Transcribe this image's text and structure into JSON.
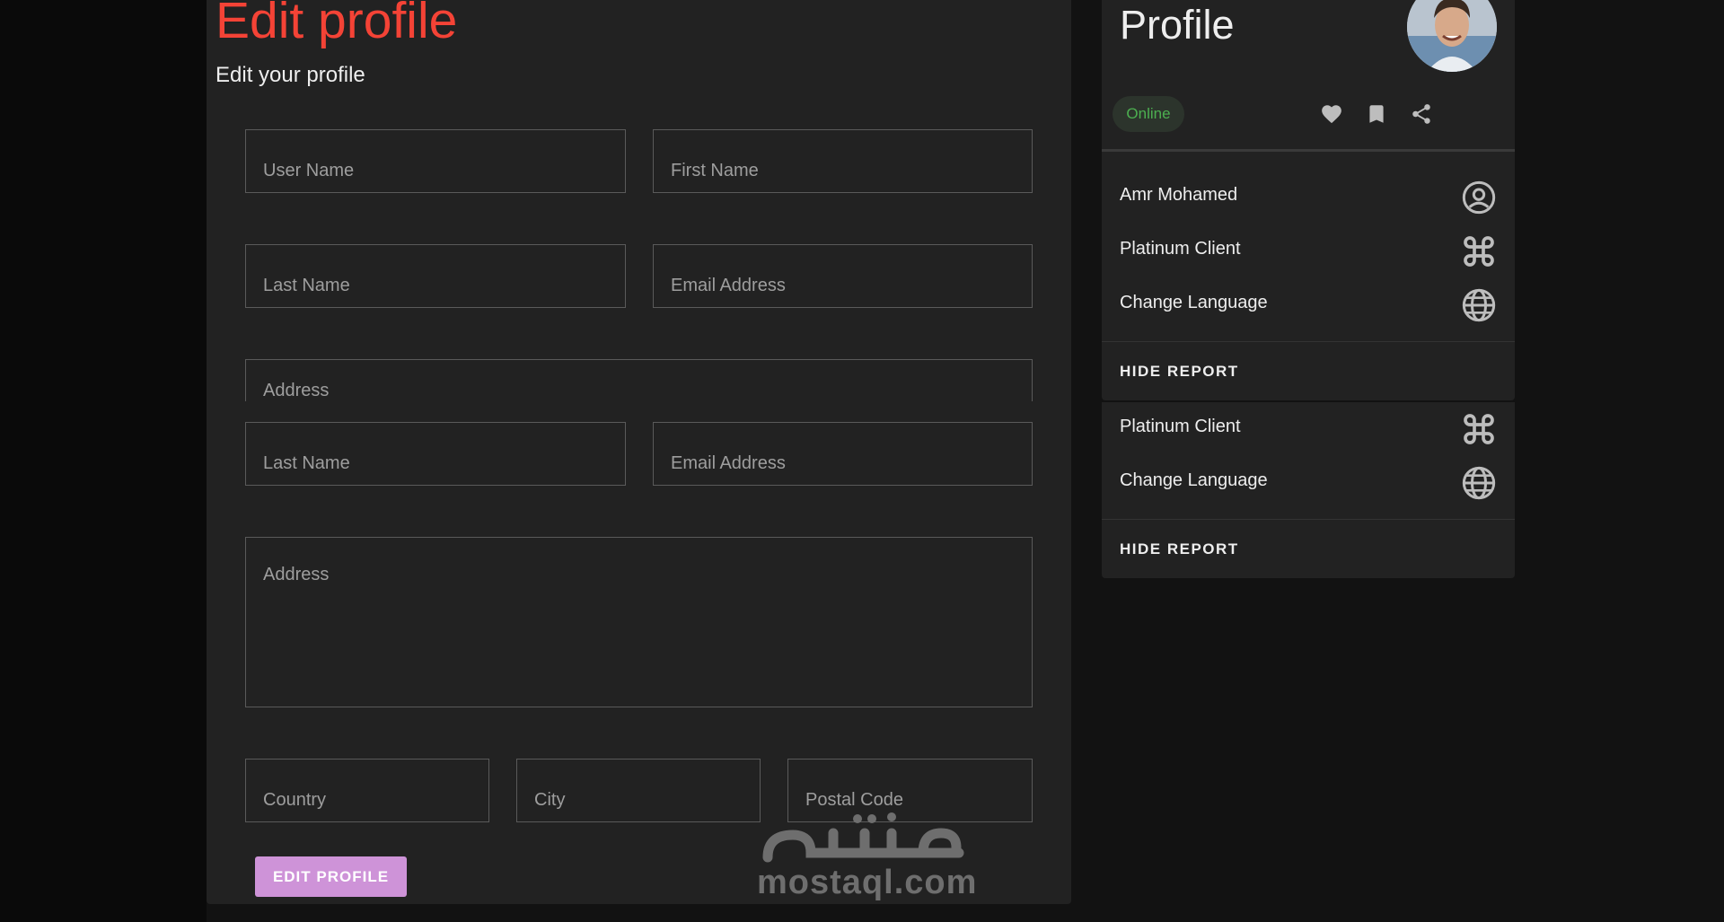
{
  "edit_form": {
    "title": "Edit profile",
    "subtitle": "Edit your profile",
    "fields": {
      "user_name": "User Name",
      "first_name": "First Name",
      "last_name": "Last Name",
      "email": "Email Address",
      "address": "Address",
      "country": "Country",
      "city": "City",
      "postal_code": "Postal Code"
    },
    "submit_label": "EDIT PROFILE"
  },
  "profile": {
    "title": "Profile",
    "status": "Online",
    "status_color": "#4caf50",
    "actions": [
      "heart-icon",
      "bookmark-icon",
      "share-icon"
    ],
    "items": [
      {
        "label": "Amr Mohamed",
        "icon": "account-circle-icon"
      },
      {
        "label": "Platinum Client",
        "icon": "command-icon"
      },
      {
        "label": "Change Language",
        "icon": "globe-icon"
      }
    ],
    "hide_report_label": "HIDE REPORT",
    "items_repeat": [
      {
        "label": "Platinum Client",
        "icon": "command-icon"
      },
      {
        "label": "Change Language",
        "icon": "globe-icon"
      }
    ]
  },
  "watermark": {
    "arabic": "مستقل",
    "text": "mostaql.com"
  },
  "colors": {
    "accent_title": "#f44336",
    "button": "#ce93d8",
    "background": "#121212",
    "card": "#222222"
  }
}
